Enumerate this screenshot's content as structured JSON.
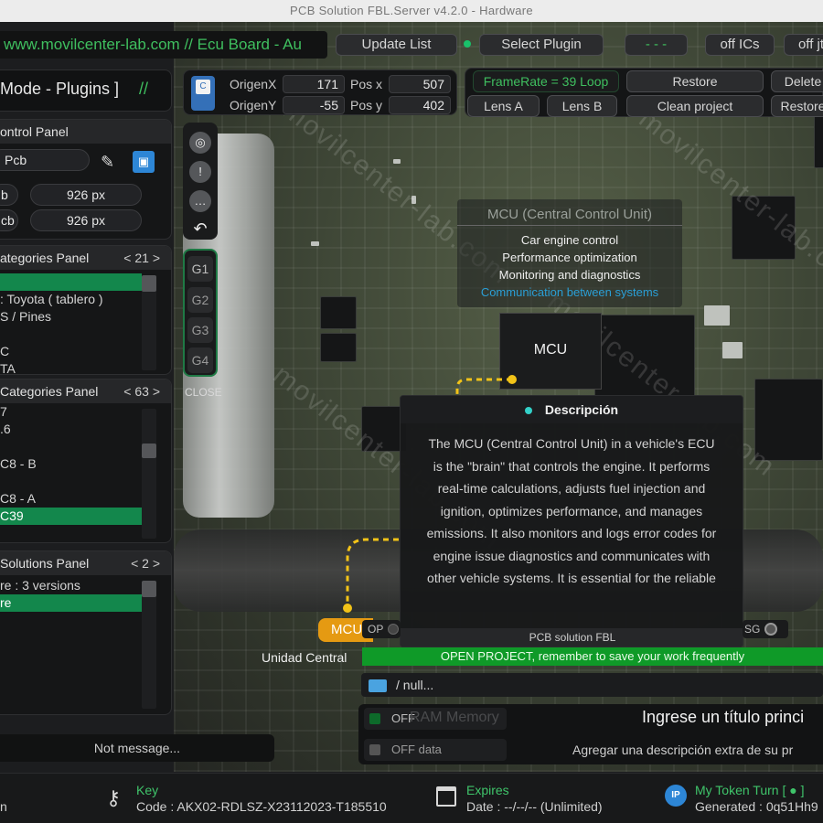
{
  "window": {
    "title": "PCB Solution FBL.Server v4.2.0 - Hardware"
  },
  "toolbar": {
    "site_text": "www.movilcenter-lab.com  // Ecu Board - Au",
    "update_list": "Update List",
    "select_plugin": "Select Plugin",
    "dashes": "- - -",
    "off_ics": "off ICs",
    "off_j": "off jt"
  },
  "mode_panel": {
    "title": "Mode - Plugins ]",
    "slashes": "//"
  },
  "control_panel": {
    "title": "ontrol Panel",
    "pcb_field": "Pcb",
    "width_label": "b",
    "width_value": "926 px",
    "height_label": "cb",
    "height_value": "926 px"
  },
  "categories_panel": {
    "title": "ategories Panel",
    "count": "< 21 >",
    "items": [
      "",
      ": Toyota ( tablero )",
      "S / Pines",
      "",
      "C",
      "TA"
    ],
    "selected_index": 0
  },
  "sub_categories_panel": {
    "title": "Categories Panel",
    "count": "< 63 >",
    "items": [
      "7",
      ".6",
      "",
      "C8 - B",
      "",
      "C8 - A",
      "C39"
    ],
    "selected_index": 6
  },
  "solutions_panel": {
    "title": "Solutions Panel",
    "count": "< 2 >",
    "items": [
      "re : 3 versions",
      "re"
    ],
    "selected_index": 1
  },
  "message_bar": {
    "text": "Not message..."
  },
  "coords": {
    "origen_x_label": "OrigenX",
    "origen_x": "171",
    "pos_x_label": "Pos x",
    "pos_x": "507",
    "origen_y_label": "OrigenY",
    "origen_y": "-55",
    "pos_y_label": "Pos y",
    "pos_y": "402"
  },
  "view_controls": {
    "framerate": "FrameRate = 39 Loop",
    "restore": "Restore",
    "delete": "Delete",
    "lens_a": "Lens A",
    "lens_b": "Lens B",
    "clean_project": "Clean project",
    "restore2": "Restore"
  },
  "groups": {
    "g1": "G1",
    "g2": "G2",
    "g3": "G3",
    "g4": "G4",
    "close": "CLOSE"
  },
  "mcu_info": {
    "title": "MCU (Central Control Unit)",
    "lines": [
      "Car engine control",
      "Performance optimization",
      "Monitoring and diagnostics"
    ],
    "link": "Communication between systems",
    "chip_label": "MCU"
  },
  "description": {
    "header": "Descripción",
    "body": "The MCU (Central Control Unit) in a vehicle's ECU is the \"brain\" that controls the engine. It performs real-time calculations, adjusts fuel injection and ignition, optimizes performance, and manages emissions. It also monitors and logs error codes for engine issue diagnostics and communicates with other vehicle systems. It is essential for the reliable",
    "footer": "PCB solution FBL"
  },
  "component_tag": {
    "label": "MCU",
    "caption": "Unidad Central"
  },
  "toggles": {
    "op": "OP",
    "sg": "SG"
  },
  "open_bar": {
    "text": "OPEN PROJECT, remember to save your work frequently"
  },
  "path_bar": {
    "path": "/ null..."
  },
  "project_info": {
    "off_label": "OFF",
    "ram_placeholder": "RAM Memory",
    "title_prompt": "Ingrese un título princi",
    "off_data_label": "OFF data",
    "desc_prompt": "Agregar una descripción extra de su pr"
  },
  "footer": {
    "left_text": "n",
    "key_label": "Key",
    "key_value": "Code : AKX02-RDLSZ-X23112023-T185510",
    "expires_label": "Expires",
    "expires_value": "Date : --/--/-- (Unlimited)",
    "token_label": "My Token Turn  [ ● ]",
    "token_value": "Generated : 0q51Hh9"
  },
  "watermark": "movilcenter-lab.com",
  "colors": {
    "accent_green": "#13874c",
    "brand_green": "#3fbf5f",
    "tag_orange": "#e59a12",
    "open_bar": "#0f9a28"
  }
}
